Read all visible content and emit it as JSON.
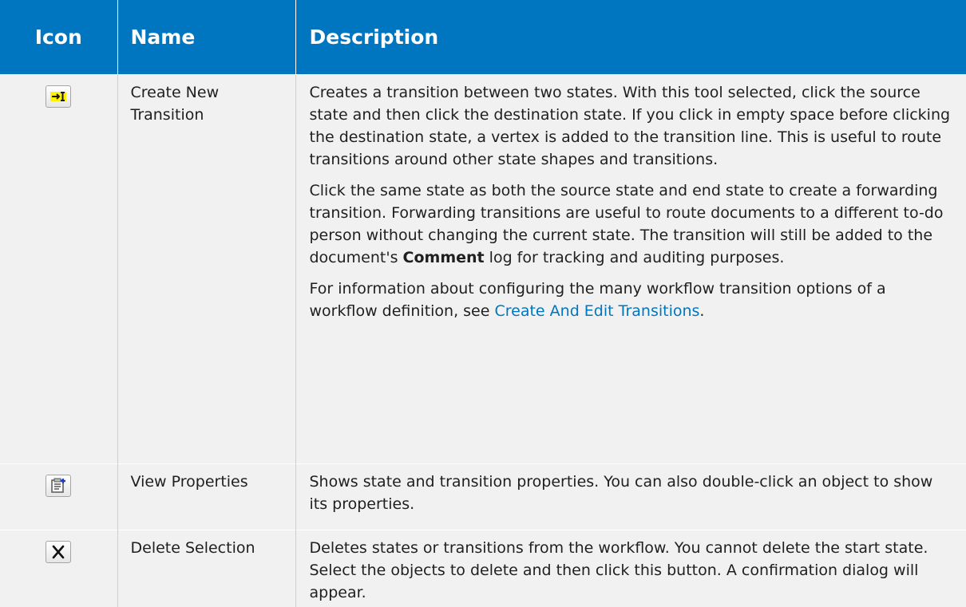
{
  "table": {
    "headers": {
      "icon": "Icon",
      "name": "Name",
      "description": "Description"
    },
    "rows": [
      {
        "icon": "create-transition-icon",
        "name": "Create New Transition",
        "p1": "Creates a transition between two states. With this tool selected, click the source state and then click the destination state. If you click in empty space before clicking the destination state, a vertex is added to the transition line. This is useful to route transitions around other state shapes and transitions.",
        "p2_before": "Click the same state as both the source state and end state to create a forwarding transition. Forwarding transitions are useful to route documents to a different to-do person without changing the current state. The transition will still be added to the document's ",
        "p2_bold": "Comment",
        "p2_after": " log for tracking and auditing purposes.",
        "p3_before": "For information about configuring the many workflow transition options of a workflow definition, see ",
        "p3_link": "Create And Edit Transitions",
        "p3_after": "."
      },
      {
        "icon": "view-properties-icon",
        "name": "View Properties",
        "p1": "Shows state and transition properties. You can also double-click an object to show its properties."
      },
      {
        "icon": "delete-icon",
        "name": "Delete Selection",
        "p1": "Deletes states or transitions from the workflow. You cannot delete the start state. Select the objects to delete and then click this button. A confirmation dialog will appear."
      }
    ]
  },
  "colors": {
    "header_bg": "#0076c0",
    "row_bg": "#f1f1f1",
    "link": "#0076c0"
  }
}
